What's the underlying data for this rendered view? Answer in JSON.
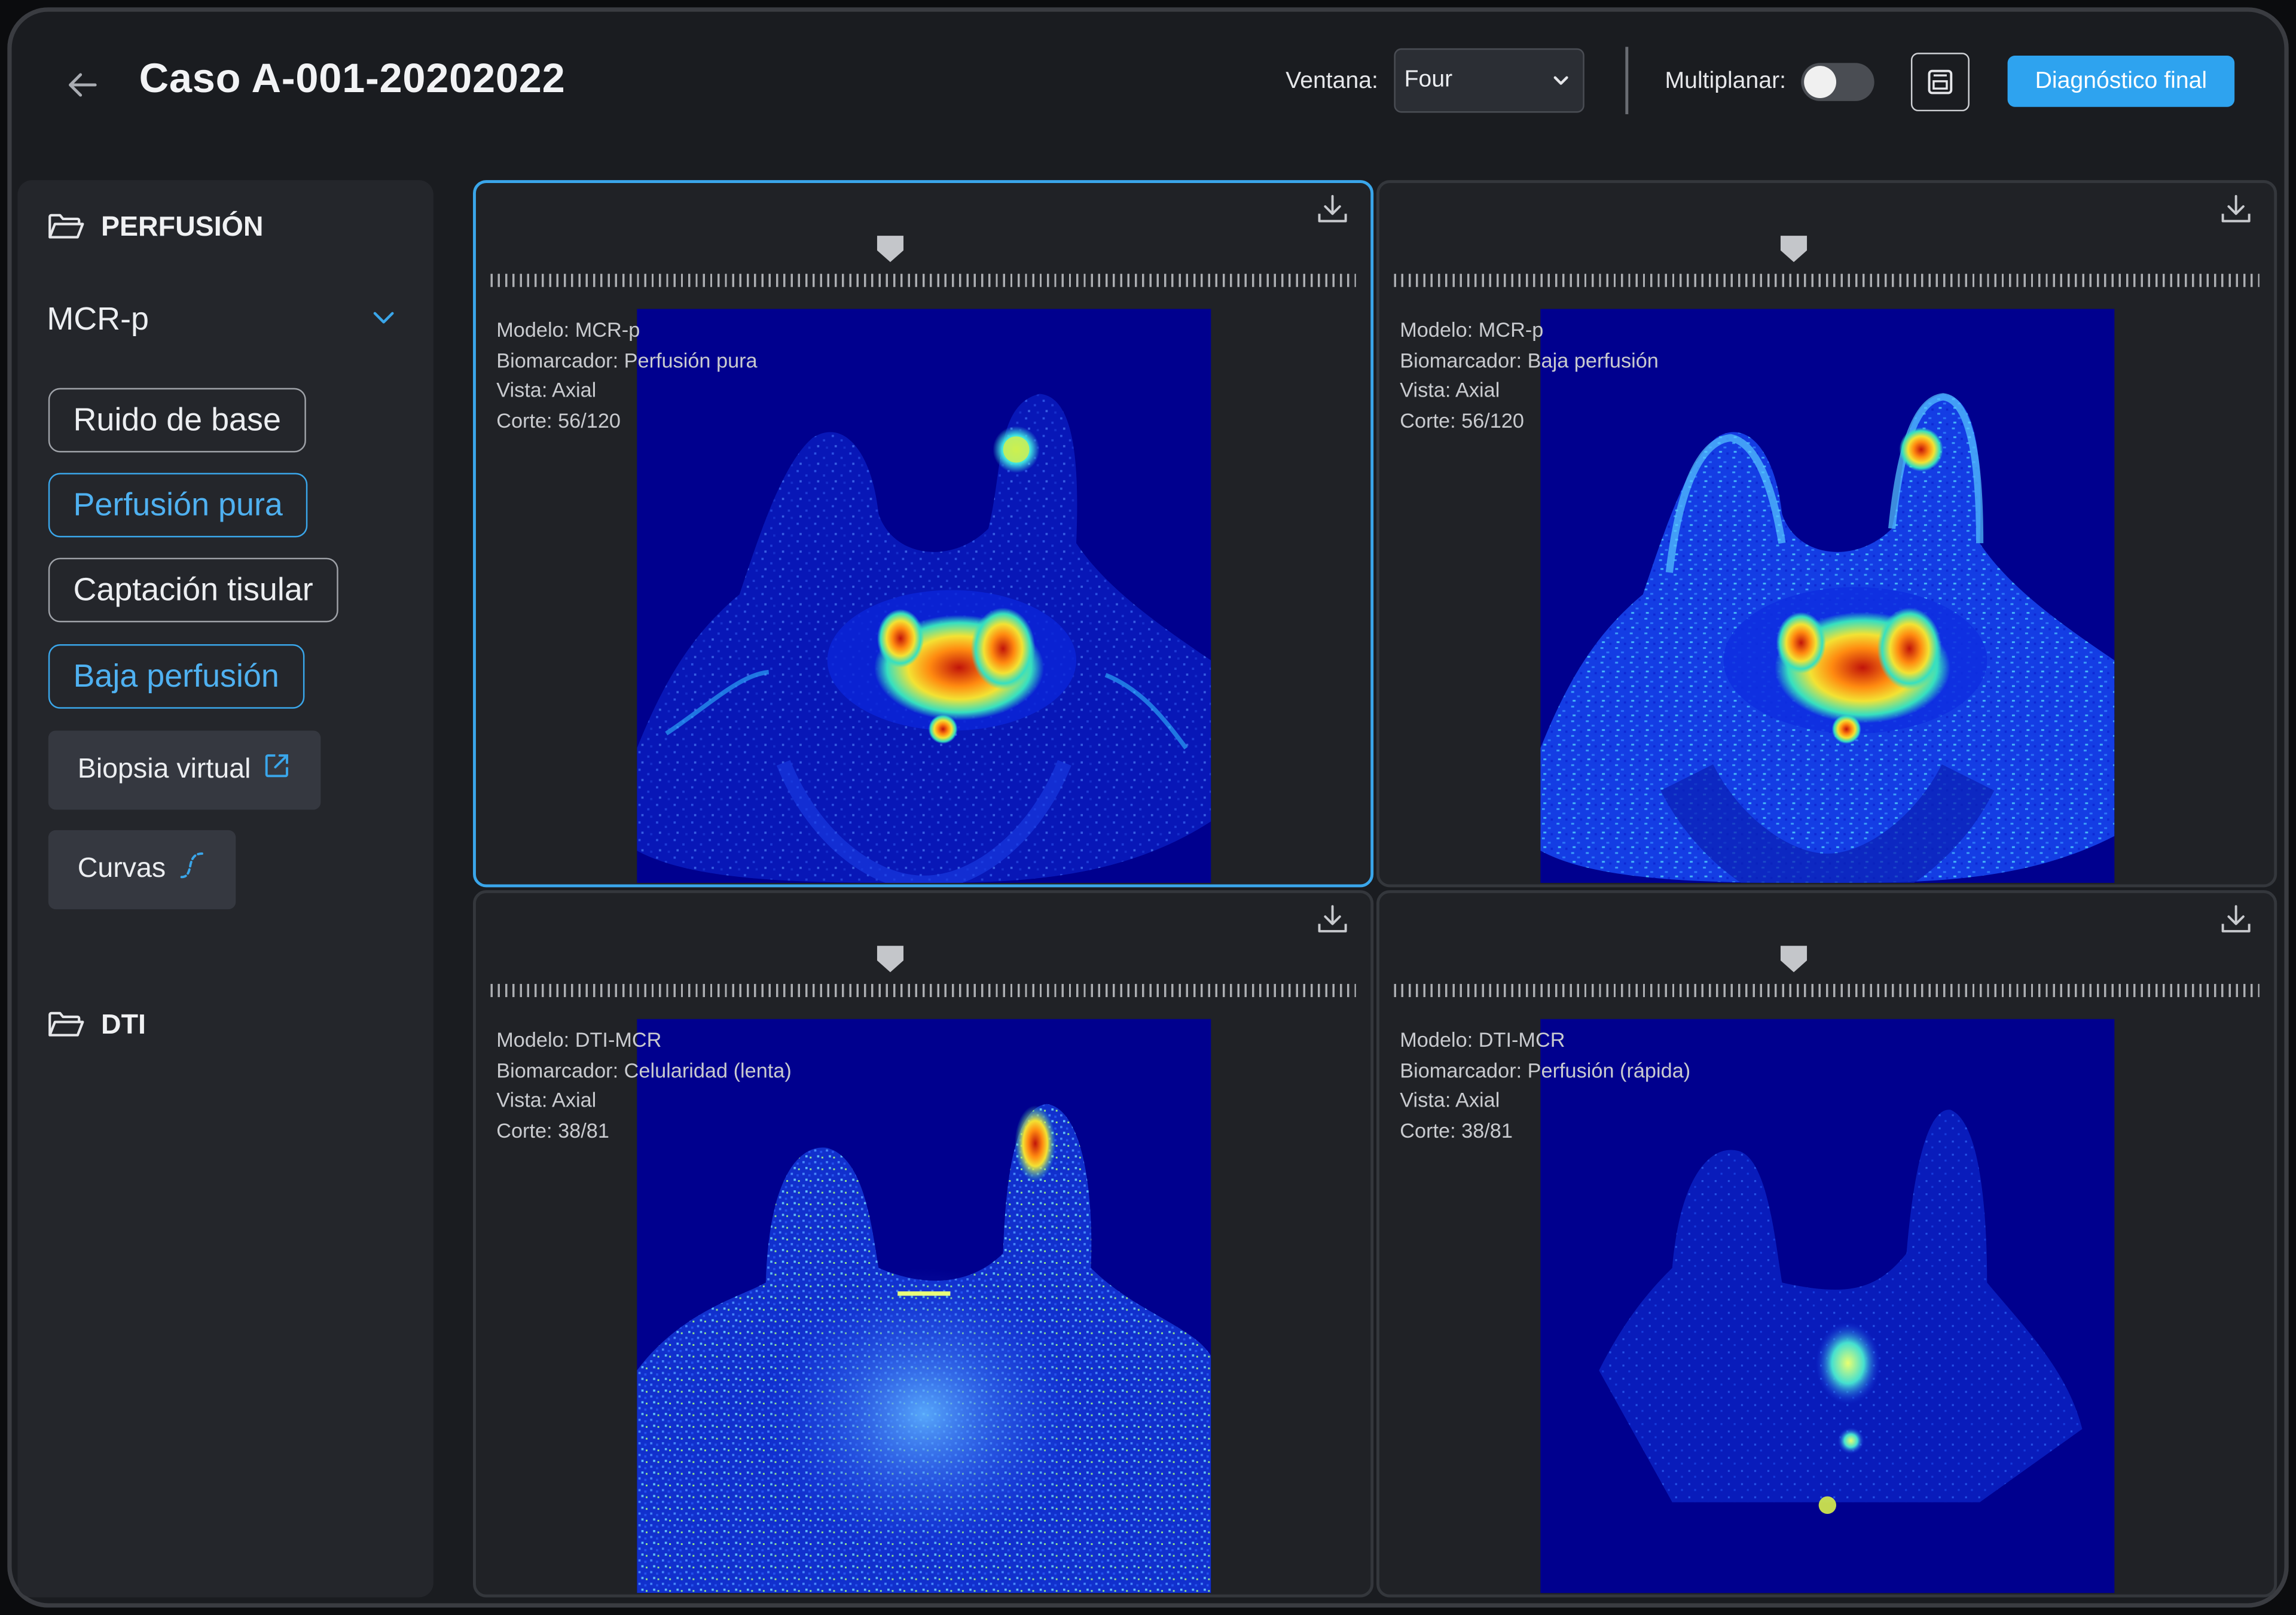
{
  "header": {
    "title": "Caso A-001-20202022",
    "ventana_label": "Ventana:",
    "ventana_value": "Four",
    "multiplanar_label": "Multiplanar:",
    "multiplanar_on": false,
    "diagnostico_label": "Diagnóstico final"
  },
  "sidebar": {
    "perfusion_title": "PERFUSIÓN",
    "model_selected": "MCR-p",
    "biomarkers": [
      {
        "label": "Ruido de base",
        "active": false
      },
      {
        "label": "Perfusión pura",
        "active": true
      },
      {
        "label": "Captación tisular",
        "active": false
      },
      {
        "label": "Baja perfusión",
        "active": true
      }
    ],
    "biopsia_label": "Biopsia virtual",
    "curvas_label": "Curvas",
    "dti_title": "DTI"
  },
  "viewports": [
    {
      "modelo": "Modelo: MCR-p",
      "biomarcador": "Biomarcador: Perfusión pura",
      "vista": "Vista: Axial",
      "corte": "Corte: 56/120",
      "selected": true
    },
    {
      "modelo": "Modelo: MCR-p",
      "biomarcador": "Biomarcador: Baja perfusión",
      "vista": "Vista: Axial",
      "corte": "Corte: 56/120",
      "selected": false
    },
    {
      "modelo": "Modelo: DTI-MCR",
      "biomarcador": "Biomarcador: Celularidad (lenta)",
      "vista": "Vista: Axial",
      "corte": "Corte: 38/81",
      "selected": false
    },
    {
      "modelo": "Modelo: DTI-MCR",
      "biomarcador": "Biomarcador: Perfusión (rápida)",
      "vista": "Vista: Axial",
      "corte": "Corte: 38/81",
      "selected": false
    }
  ],
  "colors": {
    "accent": "#2ea3ef",
    "scan_background": "#00008e",
    "panel_border_selected": "#3aa6ea"
  }
}
